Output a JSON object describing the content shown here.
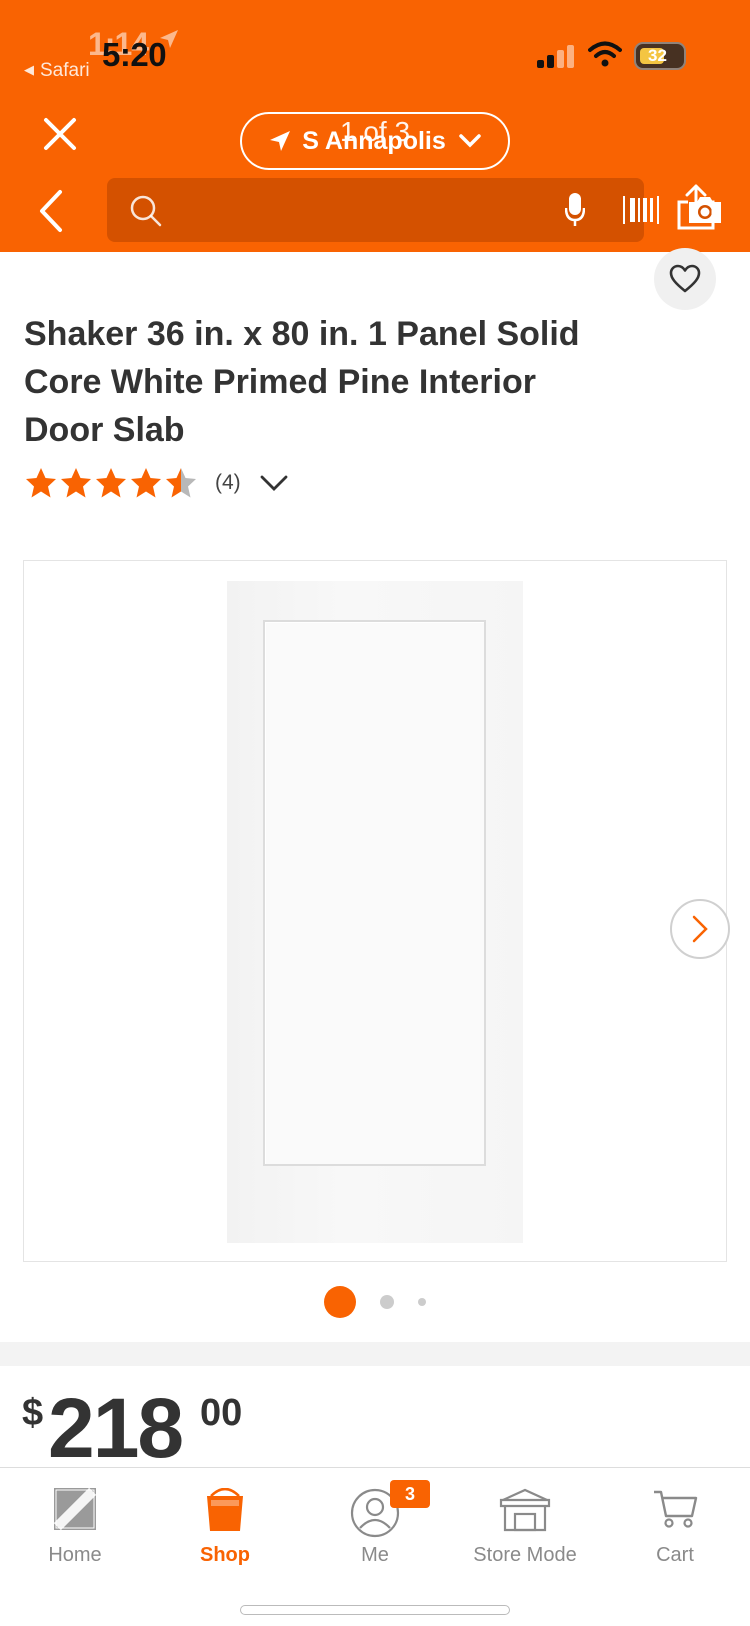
{
  "status_bar": {
    "time_ghost": "1:14",
    "time": "5:20",
    "back_app": "Safari",
    "battery": "32"
  },
  "header": {
    "store_name": "S Annapolis",
    "page_counter": "1 of 3",
    "search_placeholder": ""
  },
  "product": {
    "title": "Shaker 36 in. x 80 in. 1 Panel Solid Core White Primed Pine Interior Door Slab",
    "rating": 4.5,
    "review_count": "(4)",
    "image_count": 3,
    "active_image": 1
  },
  "price": {
    "currency": "$",
    "dollars": "218",
    "cents": "00"
  },
  "tabs": [
    {
      "label": "Home",
      "icon": "home-depot-logo-icon",
      "active": false
    },
    {
      "label": "Shop",
      "icon": "shop-bucket-icon",
      "active": true
    },
    {
      "label": "Me",
      "icon": "person-icon",
      "active": false,
      "badge": "3"
    },
    {
      "label": "Store Mode",
      "icon": "store-icon",
      "active": false
    },
    {
      "label": "Cart",
      "icon": "cart-icon",
      "active": false
    }
  ],
  "colors": {
    "brand_orange": "#f96302",
    "search_bg": "#d45100",
    "text_dark": "#333333",
    "text_muted": "#8a8a8a"
  }
}
